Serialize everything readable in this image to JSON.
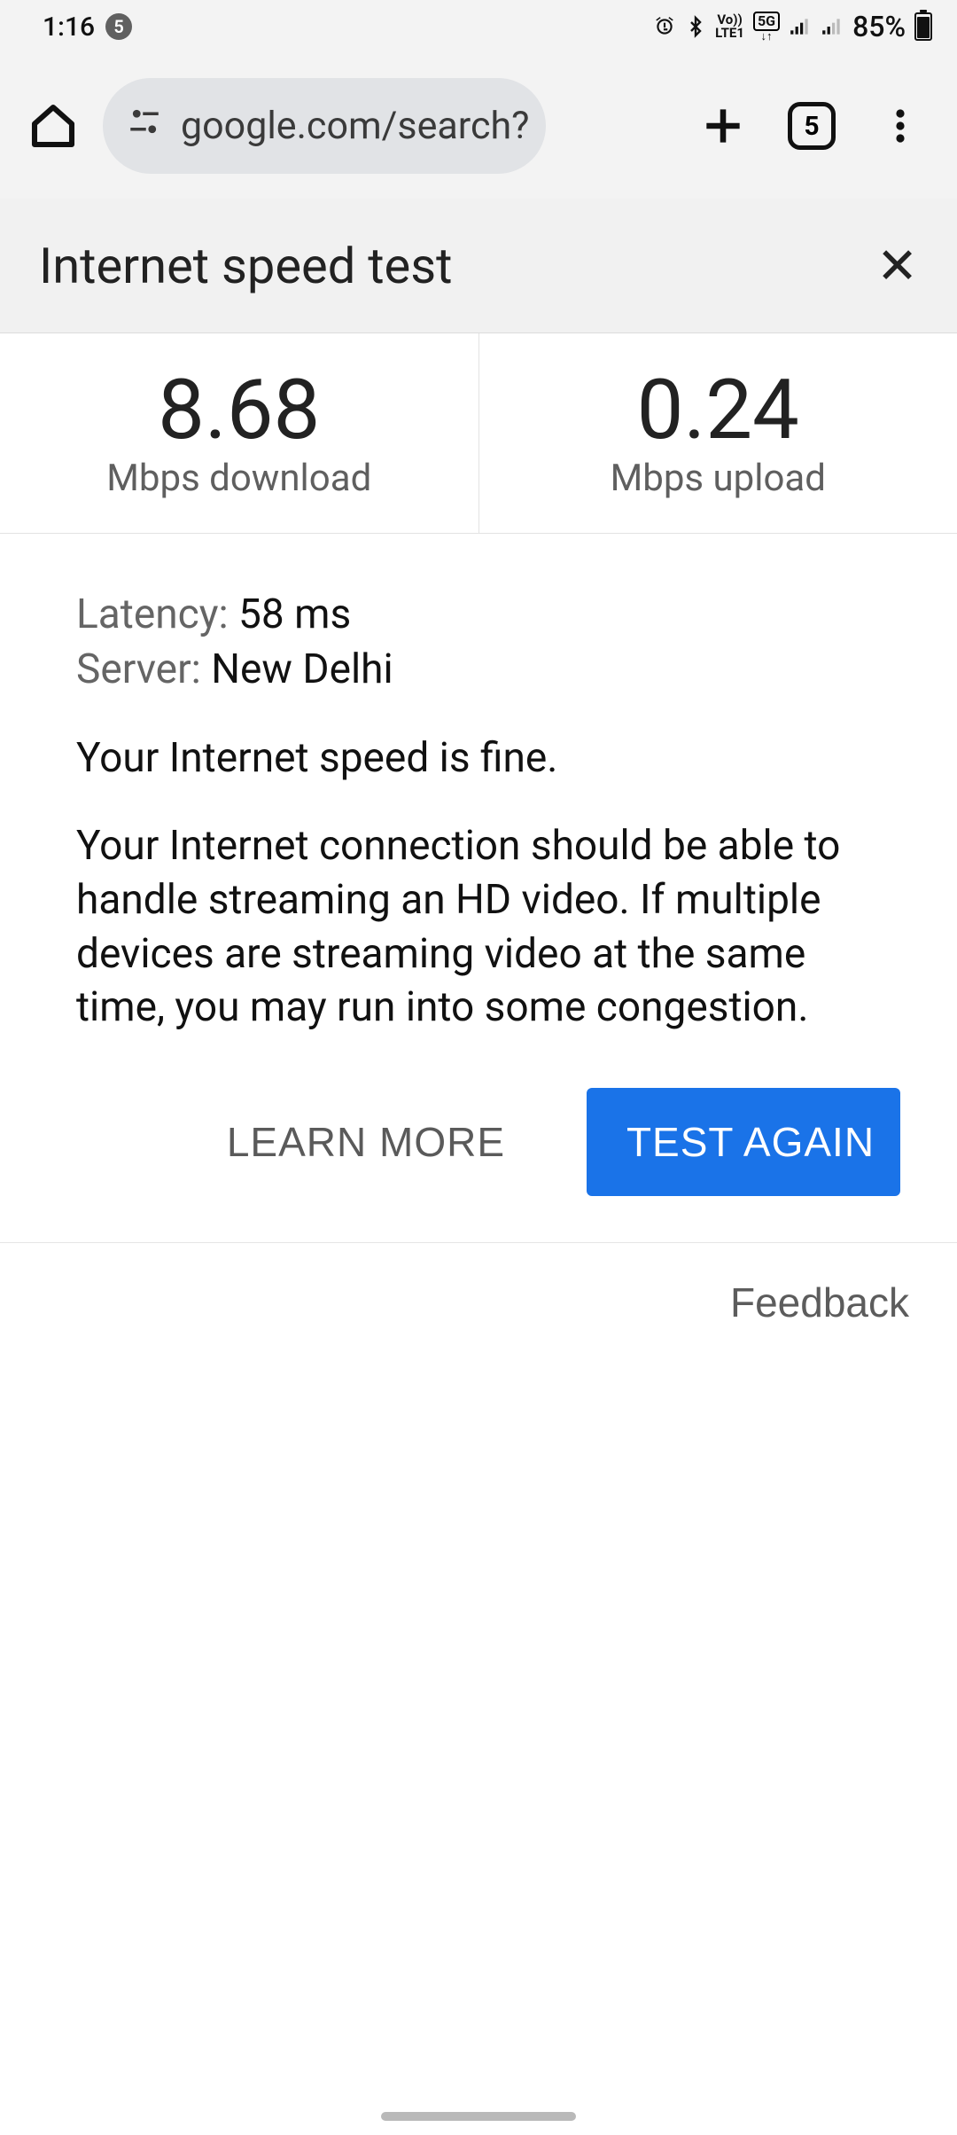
{
  "status": {
    "time": "1:16",
    "notif_count": "5",
    "volte_label": "Vo))\nLTE1",
    "network_label": "5G",
    "battery": "85%"
  },
  "toolbar": {
    "url": "google.com/search?",
    "tab_count": "5"
  },
  "card": {
    "title": "Internet speed test"
  },
  "speed": {
    "download_value": "8.68",
    "download_label": "Mbps download",
    "upload_value": "0.24",
    "upload_label": "Mbps upload"
  },
  "latency": {
    "key": "Latency: ",
    "value": "58 ms"
  },
  "server": {
    "key": "Server: ",
    "value": "New Delhi"
  },
  "summary": "Your Internet speed is fine.",
  "description": "Your Internet connection should be able to handle streaming an HD video. If multiple devices are streaming video at the same time, you may run into some congestion.",
  "buttons": {
    "learn_more": "LEARN MORE",
    "test_again": "TEST AGAIN"
  },
  "feedback": "Feedback"
}
